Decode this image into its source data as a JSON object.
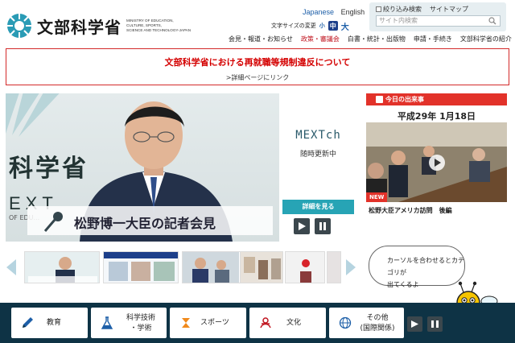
{
  "header": {
    "logo_jp": "文部科学省",
    "logo_en": [
      "MINISTRY OF EDUCATION,",
      "CULTURE, SPORTS,",
      "SCIENCE AND TECHNOLOGY-JAPAN"
    ],
    "lang_ja": "Japanese",
    "lang_en": "English",
    "fontsize_label": "文字サイズの変更",
    "fontsize_small": "小",
    "fontsize_medium": "中",
    "fontsize_large": "大",
    "refine_search": "絞り込み検索",
    "sitemap": "サイトマップ",
    "search_placeholder": "サイト内検索",
    "nav": [
      "会見・報道・お知らせ",
      "政策・審議会",
      "白書・統計・出版物",
      "申請・手続き",
      "文部科学省の紹介"
    ],
    "nav_active_index": 1
  },
  "notice": {
    "title": "文部科学省における再就職等規制違反について",
    "link": ">詳細ページにリンク"
  },
  "hero": {
    "bg_text": "科学省",
    "bg_text2": "EXT",
    "bg_text3": "OF EDU...",
    "caption": "松野博一大臣の記者会見",
    "mext_logo": "MEXTch",
    "mext_sub": "随時更新中",
    "more_button": "詳細を見る"
  },
  "today": {
    "header": "今日の出来事",
    "date": "平成29年 1月18日",
    "new_badge": "NEW",
    "caption": "松野大臣アメリカ訪問　後編"
  },
  "thumbnails": [
    {
      "name": "thumb-minister",
      "color": "#d7e8ea"
    },
    {
      "name": "thumb-sports",
      "color": "#c9dbe8"
    },
    {
      "name": "thumb-astronaut",
      "color": "#9cb1c2"
    },
    {
      "name": "thumb-ceremony",
      "color": "#b7a28e"
    },
    {
      "name": "thumb-flag",
      "color": "#f0f0f0"
    }
  ],
  "help_bubble": [
    "カーソルを合わせるとカテゴリが",
    "出てくるよ"
  ],
  "categories": [
    {
      "label": "教育",
      "icon": "pencil-icon"
    },
    {
      "label": "科学技術\n・学術",
      "icon": "flask-icon"
    },
    {
      "label": "スポーツ",
      "icon": "sports-icon"
    },
    {
      "label": "文化",
      "icon": "culture-icon"
    },
    {
      "label": "その他\n(国際関係)",
      "icon": "globe-icon"
    }
  ],
  "colors": {
    "accent_red": "#d40000",
    "teal": "#27a4b5",
    "category_bar": "#0e3345",
    "link_blue": "#1d5fa8"
  }
}
